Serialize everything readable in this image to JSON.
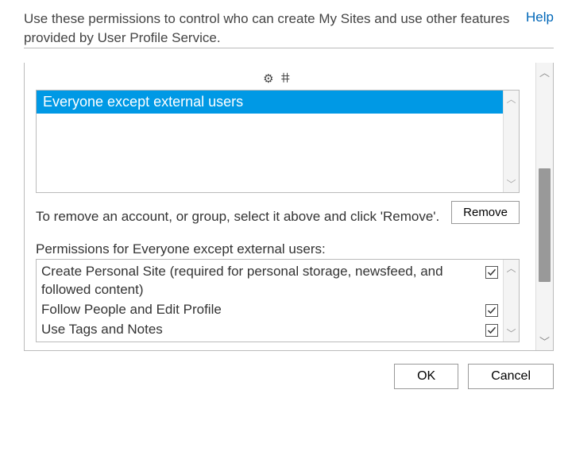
{
  "header": {
    "description": "Use these permissions to control who can create My Sites and use other features provided by User Profile Service.",
    "help_label": "Help"
  },
  "toolbar": {
    "icons_text": "⚙  𐄹"
  },
  "accounts": {
    "items": [
      {
        "label": "Everyone except external users",
        "selected": true
      }
    ]
  },
  "remove": {
    "instruction": "To remove an account, or group, select it above and click 'Remove'.",
    "button_label": "Remove"
  },
  "permissions": {
    "label_prefix": "Permissions for ",
    "target": "Everyone except external users",
    "label_suffix": ":",
    "items": [
      {
        "label": "Create Personal Site (required for personal storage, newsfeed, and followed content)",
        "checked": true
      },
      {
        "label": "Follow People and Edit Profile",
        "checked": true
      },
      {
        "label": "Use Tags and Notes",
        "checked": true
      }
    ]
  },
  "buttons": {
    "ok_label": "OK",
    "cancel_label": "Cancel"
  }
}
